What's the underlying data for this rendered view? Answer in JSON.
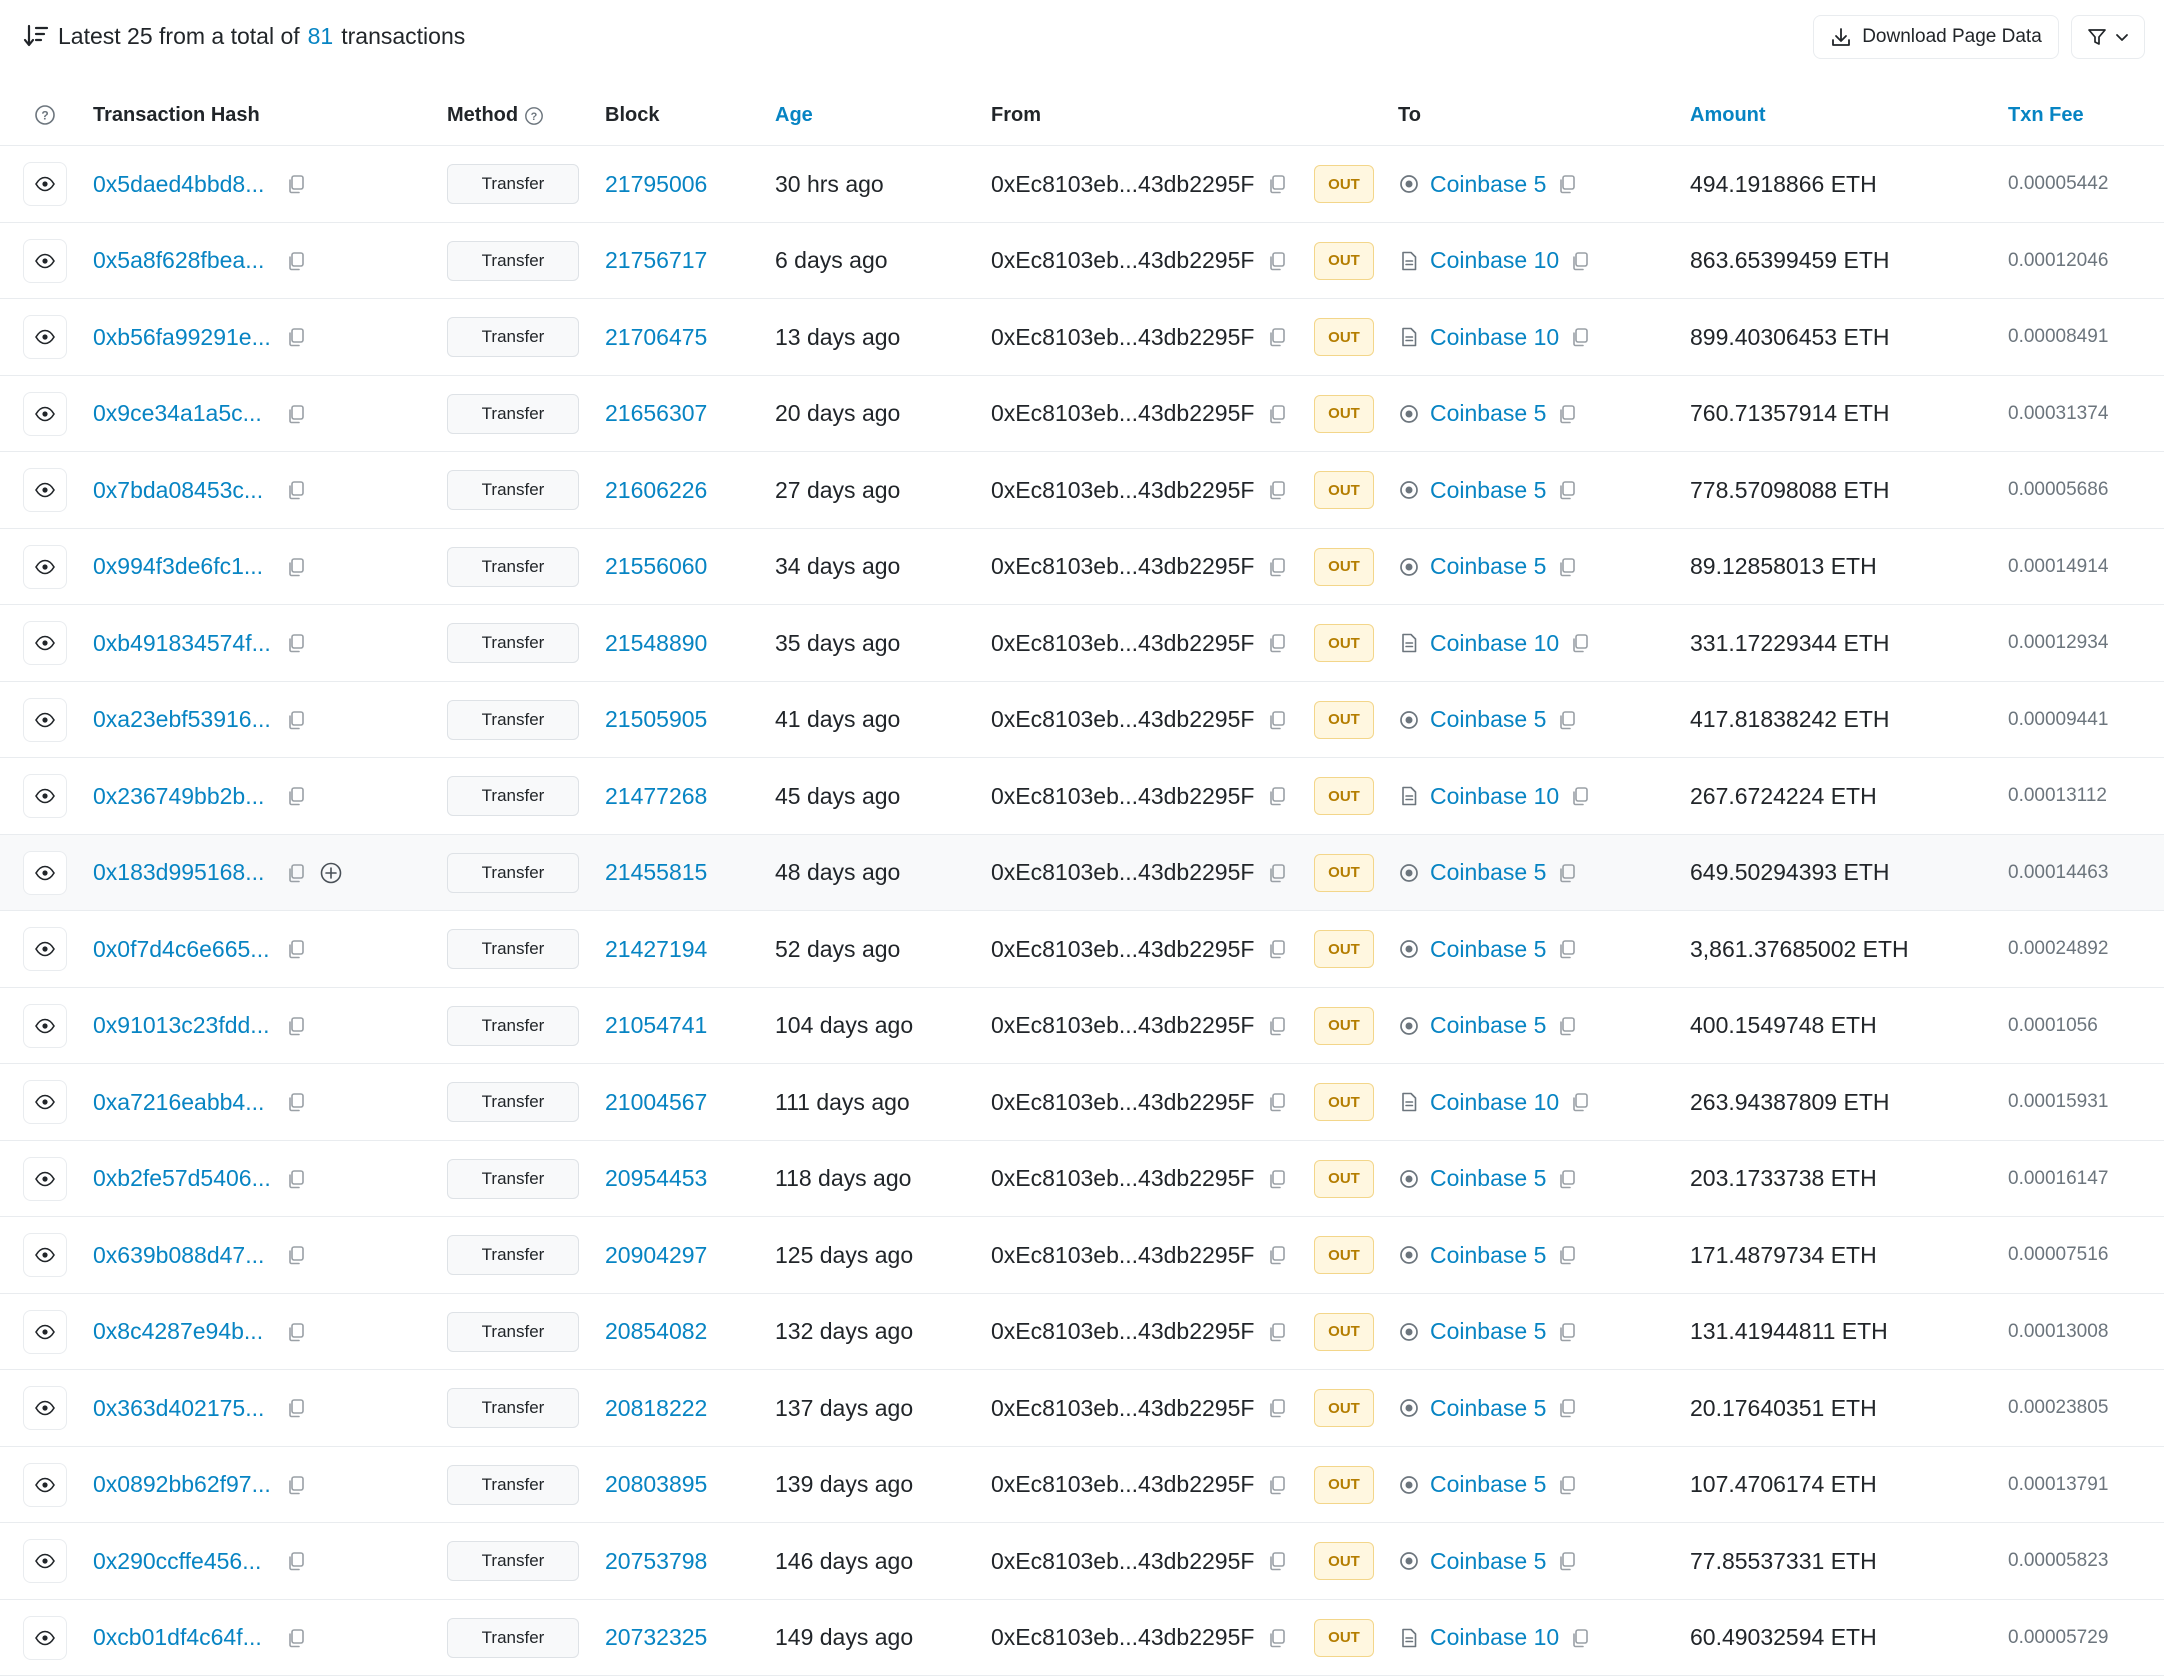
{
  "summary": {
    "prefix": "Latest 25 from a total of",
    "total": "81",
    "suffix": "transactions"
  },
  "toolbar": {
    "download_label": "Download Page Data"
  },
  "columns": {
    "transaction_hash": "Transaction Hash",
    "method": "Method",
    "block": "Block",
    "age": "Age",
    "from": "From",
    "to": "To",
    "amount": "Amount",
    "txn_fee": "Txn Fee"
  },
  "rows": [
    {
      "hash": "0x5daed4bbd8...",
      "method": "Transfer",
      "block": "21795006",
      "age": "30 hrs ago",
      "from": "0xEc8103eb...43db2295F",
      "direction": "OUT",
      "to": "Coinbase 5",
      "to_icon": "circle-icon",
      "amount": "494.1918866 ETH",
      "fee": "0.00005442"
    },
    {
      "hash": "0x5a8f628fbea...",
      "method": "Transfer",
      "block": "21756717",
      "age": "6 days ago",
      "from": "0xEc8103eb...43db2295F",
      "direction": "OUT",
      "to": "Coinbase 10",
      "to_icon": "file-icon",
      "amount": "863.65399459 ETH",
      "fee": "0.00012046"
    },
    {
      "hash": "0xb56fa99291e...",
      "method": "Transfer",
      "block": "21706475",
      "age": "13 days ago",
      "from": "0xEc8103eb...43db2295F",
      "direction": "OUT",
      "to": "Coinbase 10",
      "to_icon": "file-icon",
      "amount": "899.40306453 ETH",
      "fee": "0.00008491"
    },
    {
      "hash": "0x9ce34a1a5c...",
      "method": "Transfer",
      "block": "21656307",
      "age": "20 days ago",
      "from": "0xEc8103eb...43db2295F",
      "direction": "OUT",
      "to": "Coinbase 5",
      "to_icon": "circle-icon",
      "amount": "760.71357914 ETH",
      "fee": "0.00031374"
    },
    {
      "hash": "0x7bda08453c...",
      "method": "Transfer",
      "block": "21606226",
      "age": "27 days ago",
      "from": "0xEc8103eb...43db2295F",
      "direction": "OUT",
      "to": "Coinbase 5",
      "to_icon": "circle-icon",
      "amount": "778.57098088 ETH",
      "fee": "0.00005686"
    },
    {
      "hash": "0x994f3de6fc1...",
      "method": "Transfer",
      "block": "21556060",
      "age": "34 days ago",
      "from": "0xEc8103eb...43db2295F",
      "direction": "OUT",
      "to": "Coinbase 5",
      "to_icon": "circle-icon",
      "amount": "89.12858013 ETH",
      "fee": "0.00014914"
    },
    {
      "hash": "0xb491834574f...",
      "method": "Transfer",
      "block": "21548890",
      "age": "35 days ago",
      "from": "0xEc8103eb...43db2295F",
      "direction": "OUT",
      "to": "Coinbase 10",
      "to_icon": "file-icon",
      "amount": "331.17229344 ETH",
      "fee": "0.00012934"
    },
    {
      "hash": "0xa23ebf53916...",
      "method": "Transfer",
      "block": "21505905",
      "age": "41 days ago",
      "from": "0xEc8103eb...43db2295F",
      "direction": "OUT",
      "to": "Coinbase 5",
      "to_icon": "circle-icon",
      "amount": "417.81838242 ETH",
      "fee": "0.00009441"
    },
    {
      "hash": "0x236749bb2b...",
      "method": "Transfer",
      "block": "21477268",
      "age": "45 days ago",
      "from": "0xEc8103eb...43db2295F",
      "direction": "OUT",
      "to": "Coinbase 10",
      "to_icon": "file-icon",
      "amount": "267.6724224 ETH",
      "fee": "0.00013112"
    },
    {
      "hash": "0x183d995168...",
      "method": "Transfer",
      "block": "21455815",
      "age": "48 days ago",
      "from": "0xEc8103eb...43db2295F",
      "direction": "OUT",
      "to": "Coinbase 5",
      "to_icon": "circle-icon",
      "amount": "649.50294393 ETH",
      "fee": "0.00014463"
    },
    {
      "hash": "0x0f7d4c6e665...",
      "method": "Transfer",
      "block": "21427194",
      "age": "52 days ago",
      "from": "0xEc8103eb...43db2295F",
      "direction": "OUT",
      "to": "Coinbase 5",
      "to_icon": "circle-icon",
      "amount": "3,861.37685002 ETH",
      "fee": "0.00024892"
    },
    {
      "hash": "0x91013c23fdd...",
      "method": "Transfer",
      "block": "21054741",
      "age": "104 days ago",
      "from": "0xEc8103eb...43db2295F",
      "direction": "OUT",
      "to": "Coinbase 5",
      "to_icon": "circle-icon",
      "amount": "400.1549748 ETH",
      "fee": "0.0001056"
    },
    {
      "hash": "0xa7216eabb4...",
      "method": "Transfer",
      "block": "21004567",
      "age": "111 days ago",
      "from": "0xEc8103eb...43db2295F",
      "direction": "OUT",
      "to": "Coinbase 10",
      "to_icon": "file-icon",
      "amount": "263.94387809 ETH",
      "fee": "0.00015931"
    },
    {
      "hash": "0xb2fe57d5406...",
      "method": "Transfer",
      "block": "20954453",
      "age": "118 days ago",
      "from": "0xEc8103eb...43db2295F",
      "direction": "OUT",
      "to": "Coinbase 5",
      "to_icon": "circle-icon",
      "amount": "203.1733738 ETH",
      "fee": "0.00016147"
    },
    {
      "hash": "0x639b088d47...",
      "method": "Transfer",
      "block": "20904297",
      "age": "125 days ago",
      "from": "0xEc8103eb...43db2295F",
      "direction": "OUT",
      "to": "Coinbase 5",
      "to_icon": "circle-icon",
      "amount": "171.4879734 ETH",
      "fee": "0.00007516"
    },
    {
      "hash": "0x8c4287e94b...",
      "method": "Transfer",
      "block": "20854082",
      "age": "132 days ago",
      "from": "0xEc8103eb...43db2295F",
      "direction": "OUT",
      "to": "Coinbase 5",
      "to_icon": "circle-icon",
      "amount": "131.41944811 ETH",
      "fee": "0.00013008"
    },
    {
      "hash": "0x363d402175...",
      "method": "Transfer",
      "block": "20818222",
      "age": "137 days ago",
      "from": "0xEc8103eb...43db2295F",
      "direction": "OUT",
      "to": "Coinbase 5",
      "to_icon": "circle-icon",
      "amount": "20.17640351 ETH",
      "fee": "0.00023805"
    },
    {
      "hash": "0x0892bb62f97...",
      "method": "Transfer",
      "block": "20803895",
      "age": "139 days ago",
      "from": "0xEc8103eb...43db2295F",
      "direction": "OUT",
      "to": "Coinbase 5",
      "to_icon": "circle-icon",
      "amount": "107.4706174 ETH",
      "fee": "0.00013791"
    },
    {
      "hash": "0x290ccffe456...",
      "method": "Transfer",
      "block": "20753798",
      "age": "146 days ago",
      "from": "0xEc8103eb...43db2295F",
      "direction": "OUT",
      "to": "Coinbase 5",
      "to_icon": "circle-icon",
      "amount": "77.85537331 ETH",
      "fee": "0.00005823"
    },
    {
      "hash": "0xcb01df4c64f...",
      "method": "Transfer",
      "block": "20732325",
      "age": "149 days ago",
      "from": "0xEc8103eb...43db2295F",
      "direction": "OUT",
      "to": "Coinbase 10",
      "to_icon": "file-icon",
      "amount": "60.49032594 ETH",
      "fee": "0.00005729"
    }
  ],
  "highlighted_row": 9,
  "colors": {
    "link": "#0784c3",
    "out_badge_bg": "#fff7e0",
    "out_badge_text": "#b47d00",
    "border": "#e9ecef"
  }
}
